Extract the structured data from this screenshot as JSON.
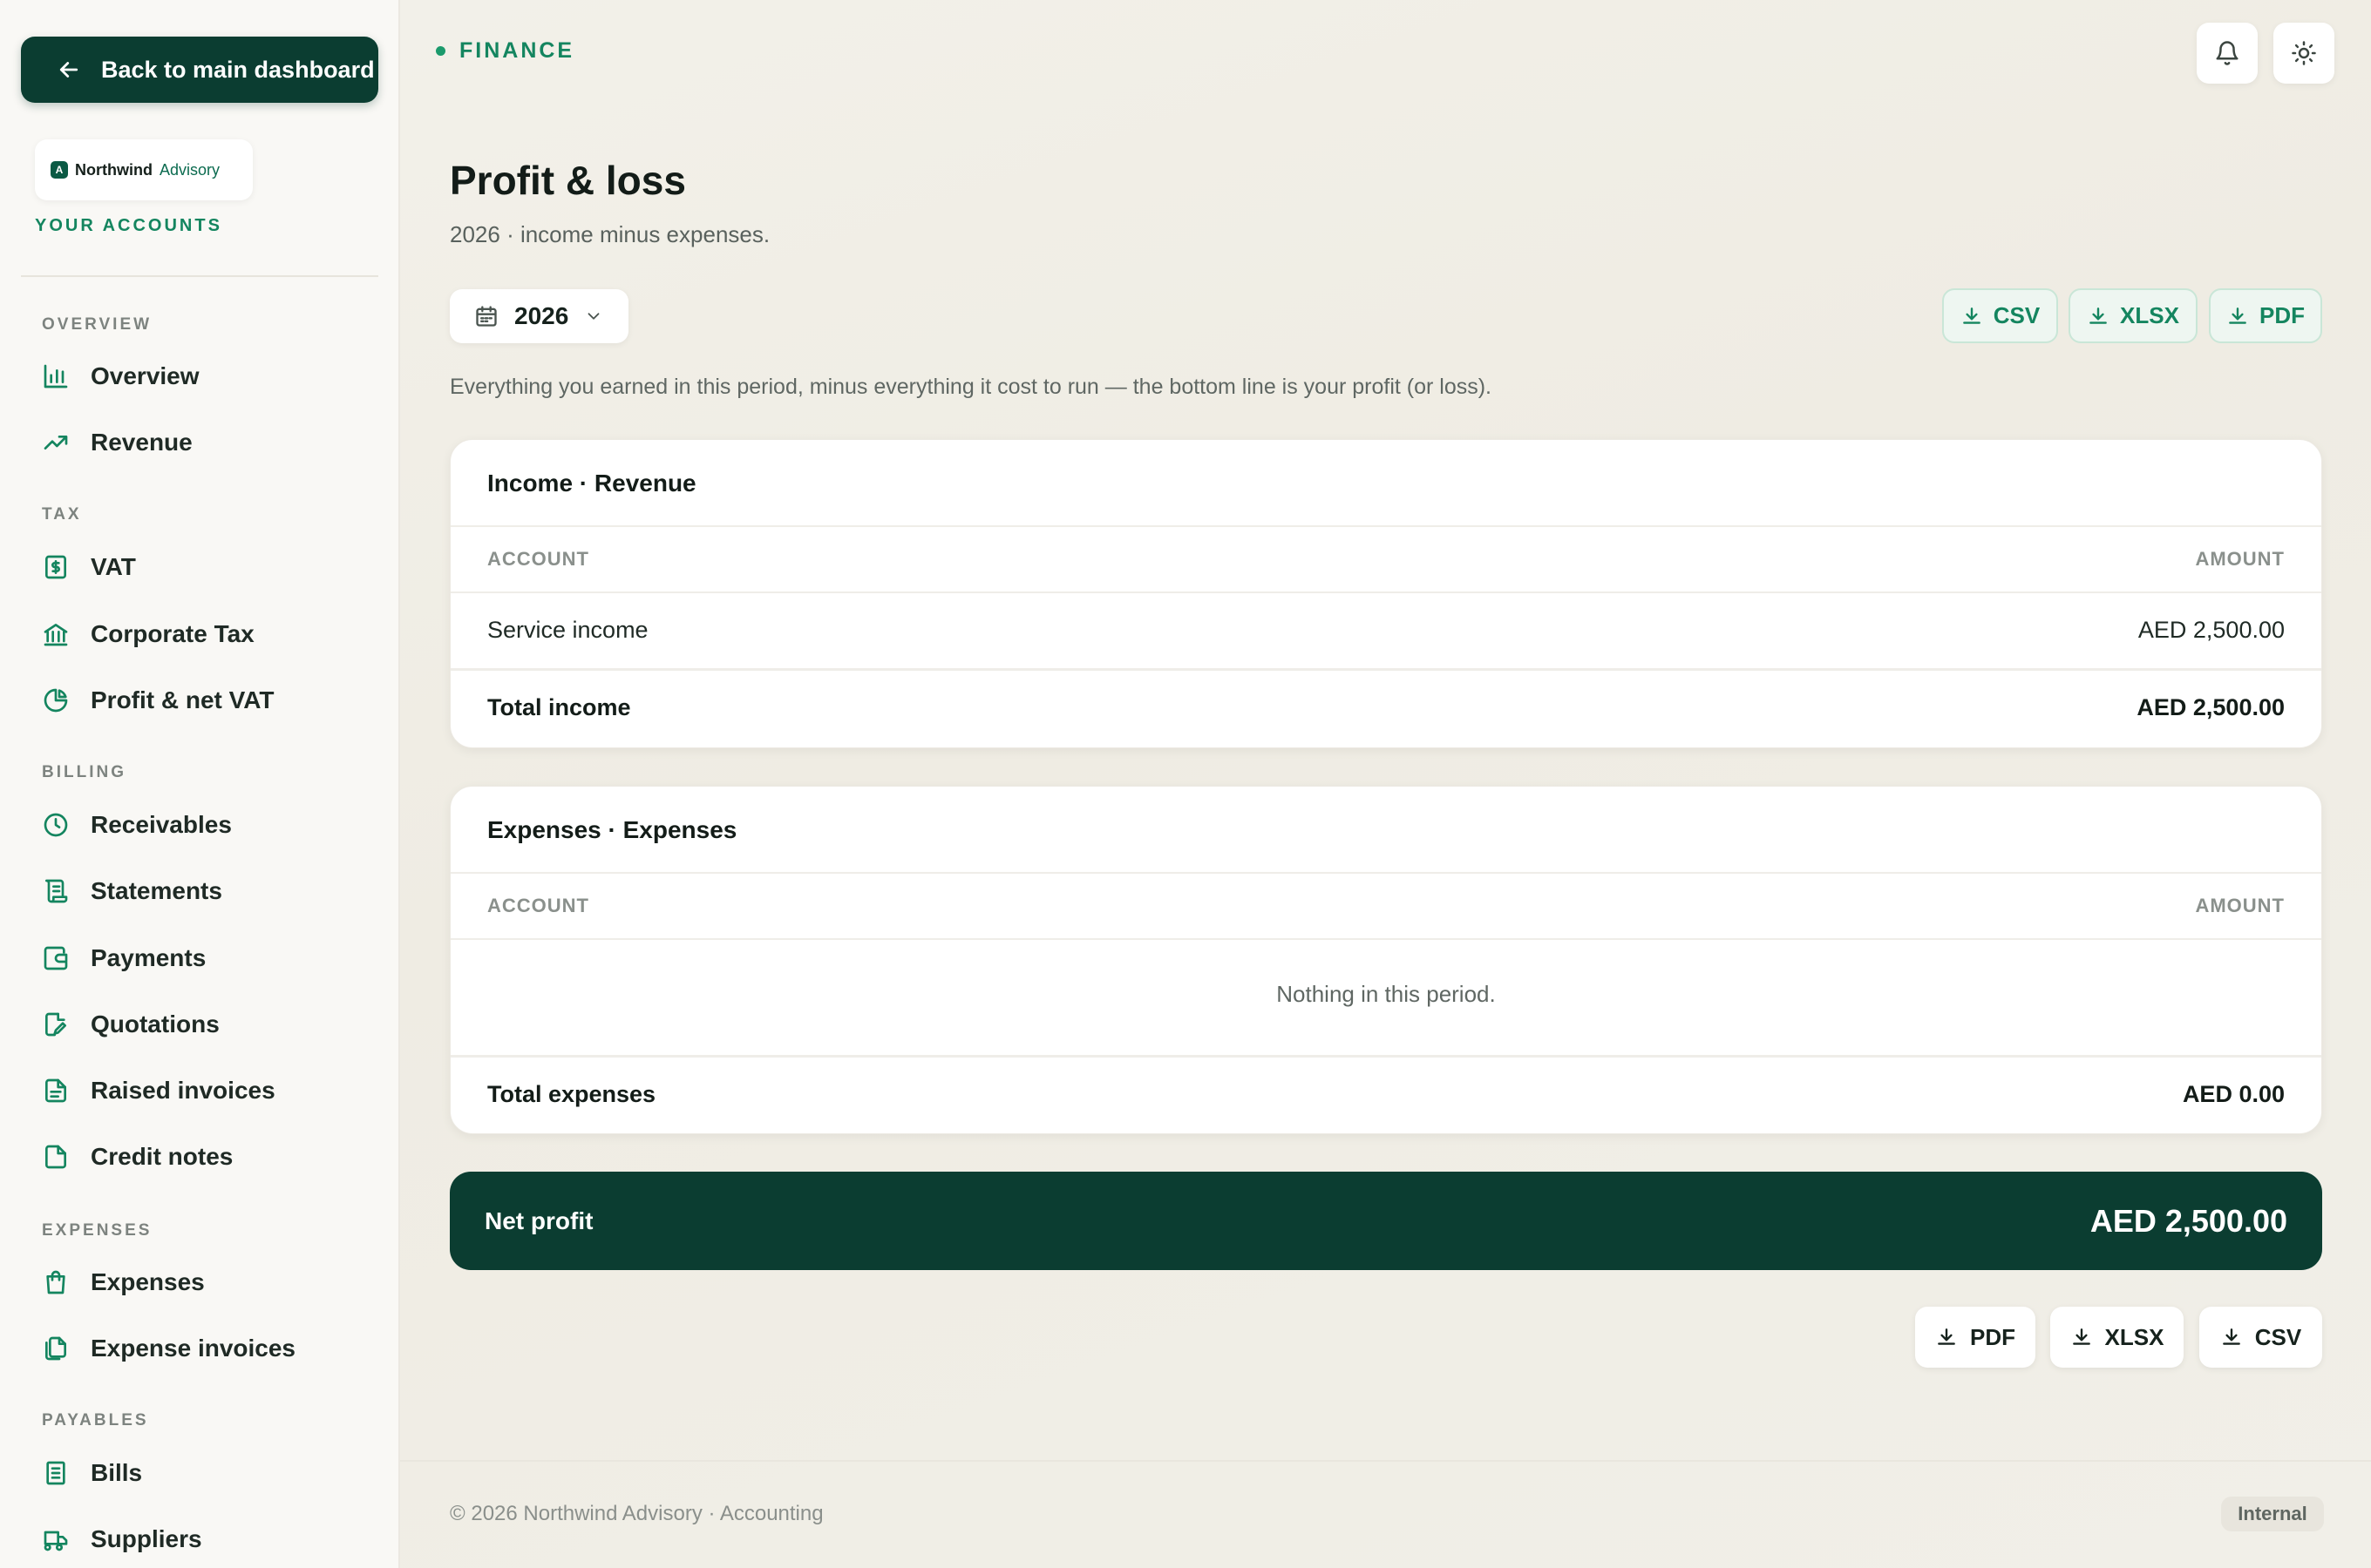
{
  "sidebar": {
    "back_label": "Back to main dashboard",
    "logo": {
      "name": "Northwind",
      "sub": "Advisory",
      "mark": "A"
    },
    "accounts_label": "YOUR ACCOUNTS",
    "sections": {
      "overview": "OVERVIEW",
      "tax": "TAX",
      "billing": "BILLING",
      "expenses": "EXPENSES",
      "payables": "PAYABLES"
    },
    "items": {
      "overview": "Overview",
      "revenue": "Revenue",
      "vat": "VAT",
      "corporate_tax": "Corporate Tax",
      "profit_net_vat": "Profit & net VAT",
      "receivables": "Receivables",
      "statements": "Statements",
      "payments": "Payments",
      "quotations": "Quotations",
      "raised_invoices": "Raised invoices",
      "credit_notes": "Credit notes",
      "expenses": "Expenses",
      "expense_invoices": "Expense invoices",
      "bills": "Bills",
      "suppliers": "Suppliers"
    }
  },
  "header": {
    "section_tag": "FINANCE",
    "bell_icon": "bell-icon",
    "theme_icon": "sun-icon"
  },
  "page": {
    "title": "Profit & loss",
    "subtitle": "2026 · income minus expenses.",
    "year": "2026",
    "helper": "Everything you earned in this period, minus everything it cost to run — the bottom line is your profit (or loss)."
  },
  "exports_top": {
    "csv": "CSV",
    "xlsx": "XLSX",
    "pdf": "PDF"
  },
  "income": {
    "title": "Income · Revenue",
    "col_account": "ACCOUNT",
    "col_amount": "AMOUNT",
    "rows": [
      {
        "account": "Service income",
        "amount": "AED 2,500.00"
      }
    ],
    "total_label": "Total income",
    "total_value": "AED 2,500.00"
  },
  "expenses": {
    "title": "Expenses · Expenses",
    "col_account": "ACCOUNT",
    "col_amount": "AMOUNT",
    "empty": "Nothing in this period.",
    "total_label": "Total expenses",
    "total_value": "AED 0.00"
  },
  "net": {
    "label": "Net profit",
    "value": "AED 2,500.00"
  },
  "exports_bottom": {
    "pdf": "PDF",
    "xlsx": "XLSX",
    "csv": "CSV"
  },
  "footer": {
    "text": "© 2026 Northwind Advisory · Accounting",
    "badge": "Internal"
  },
  "colors": {
    "primary": "#0b3d31",
    "accent": "#14855f",
    "background": "#f3f1ea"
  }
}
